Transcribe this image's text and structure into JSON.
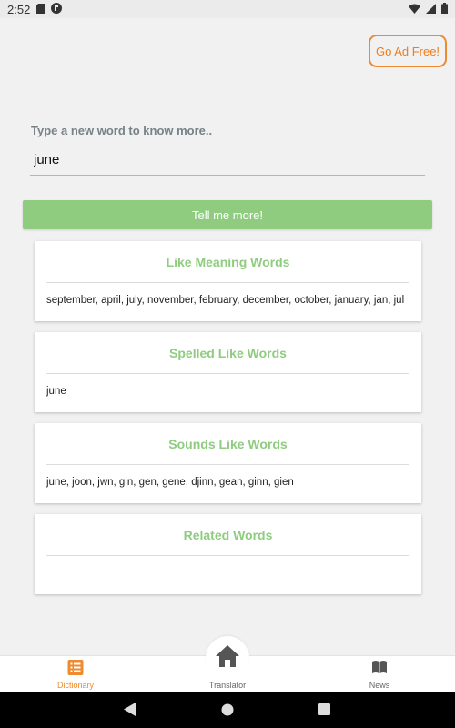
{
  "status_bar": {
    "time": "2:52"
  },
  "header": {
    "ad_free_label": "Go Ad Free!"
  },
  "search": {
    "label": "Type a new word to know more..",
    "value": "june",
    "button_label": "Tell me more!"
  },
  "cards": [
    {
      "title": "Like Meaning Words",
      "words": "september, april, july, november, february, december, october, january, jan, jul"
    },
    {
      "title": "Spelled Like Words",
      "words": "june"
    },
    {
      "title": "Sounds Like Words",
      "words": "june, joon, jwn, gin, gen, gene, djinn, gean, ginn, gien"
    },
    {
      "title": "Related Words",
      "words": ""
    }
  ],
  "bottom_nav": {
    "items": [
      {
        "label": "Dictionary",
        "icon": "list-icon",
        "active": true
      },
      {
        "label": "Translator",
        "icon": "home-icon",
        "active": false
      },
      {
        "label": "News",
        "icon": "book-icon",
        "active": false
      }
    ]
  },
  "colors": {
    "accent_green": "#8fcc80",
    "accent_orange": "#ef8a2f",
    "label_gray": "#768287"
  }
}
